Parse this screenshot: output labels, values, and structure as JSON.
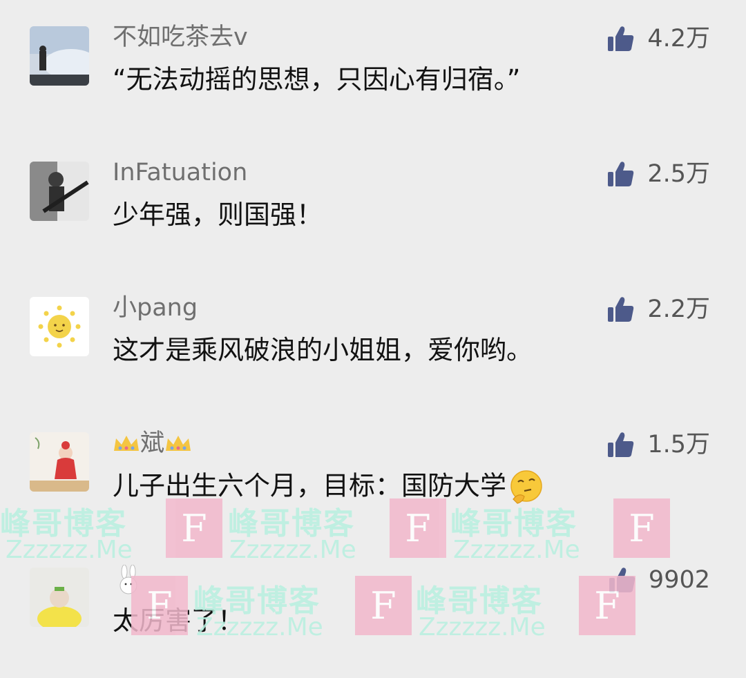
{
  "comments": [
    {
      "username": "不如吃茶去v",
      "text": "“无法动摇的思想，只因心有归宿。”",
      "likes": "4.2万"
    },
    {
      "username": "InFatuation",
      "text": "少年强，则国强！",
      "likes": "2.5万"
    },
    {
      "username": "小pang",
      "text": "这才是乘风破浪的小姐姐，爱你哟。",
      "likes": "2.2万"
    },
    {
      "username": "斌",
      "text": "儿子出生六个月，目标：国防大学",
      "likes": "1.5万"
    },
    {
      "username": "",
      "text": "太厉害了！",
      "likes": "9902"
    }
  ],
  "watermark": {
    "box_letter": "F",
    "title": "峰哥博客",
    "sub": "Zzzzzz.Me"
  },
  "colors": {
    "like_icon": "#4d5a8a",
    "background": "#ededed"
  },
  "icons": {
    "like": "thumbs-up-icon",
    "crown": "crown-icon",
    "emoji": "thinking-face-icon"
  }
}
